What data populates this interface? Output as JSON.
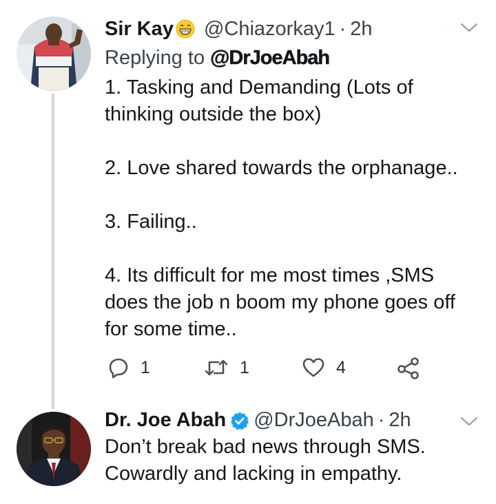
{
  "tweets": [
    {
      "name": "Sir Kay",
      "emoji": "grinning-face-emoji",
      "handle": "@Chiazorkay1",
      "separator": "·",
      "time": "2h",
      "replying_prefix": "Replying to",
      "replying_to": "@DrJoeAbah",
      "paragraphs": [
        "1. Tasking and Demanding (Lots of thinking outside the box)",
        "2. Love shared towards the orphanage..",
        "3. Failing..",
        "4. Its difficult for me most times ,SMS does the job n boom my phone goes off for some time.."
      ],
      "actions": {
        "replies": "1",
        "retweets": "1",
        "likes": "4"
      }
    },
    {
      "name": "Dr. Joe Abah",
      "verified": true,
      "handle": "@DrJoeAbah",
      "separator": "·",
      "time": "2h",
      "text_lines": [
        "Don’t break bad news through SMS.",
        "Cowardly and lacking in empathy."
      ]
    }
  ],
  "colors": {
    "text": "#14171a",
    "secondary_text": "#3b4248",
    "thread_line": "#ccd6dd",
    "verified_blue": "#1da1f2",
    "chevron": "#8899a6",
    "icon": "#4a5259"
  },
  "icons": [
    "chevron-down-icon",
    "reply-icon",
    "retweet-icon",
    "like-icon",
    "share-icon",
    "verified-badge-icon"
  ]
}
